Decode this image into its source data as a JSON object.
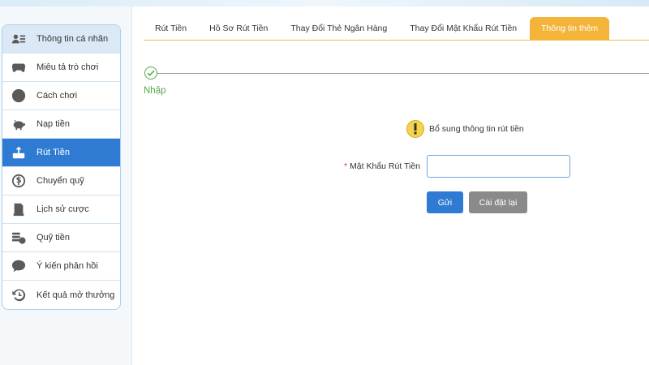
{
  "sidebar": {
    "items": [
      {
        "label": "Thông tin cá nhân",
        "icon": "profile-card-icon"
      },
      {
        "label": "Miêu tả trò chơi",
        "icon": "gamepad-icon"
      },
      {
        "label": "Cách chơi",
        "icon": "info-icon"
      },
      {
        "label": "Nạp tiền",
        "icon": "piggy-bank-icon"
      },
      {
        "label": "Rút Tiền",
        "icon": "withdraw-icon"
      },
      {
        "label": "Chuyển quỹ",
        "icon": "coin-icon"
      },
      {
        "label": "Lịch sử cược",
        "icon": "history-list-icon"
      },
      {
        "label": "Quỹ tiền",
        "icon": "money-stack-icon"
      },
      {
        "label": "Ý kiến phản hồi",
        "icon": "chat-bubble-icon"
      },
      {
        "label": "Kết quả mở thưởng",
        "icon": "clock-history-icon"
      }
    ],
    "active_index": 4
  },
  "tabs": [
    {
      "label": "Rút Tiền"
    },
    {
      "label": "Hồ Sơ Rút Tiền"
    },
    {
      "label": "Thay Đổi Thẻ Ngân Hàng"
    },
    {
      "label": "Thay Đổi Mật Khẩu Rút Tiền"
    },
    {
      "label": "Thông tin thêm"
    }
  ],
  "active_tab": 4,
  "step": {
    "label": "Nhập"
  },
  "notice": {
    "text": "Bổ sung thông tin rút tiền"
  },
  "form": {
    "required_mark": "*",
    "password_label": "Mật Khẩu Rút Tiền",
    "password_value": "",
    "submit_label": "Gửi",
    "reset_label": "Cài đặt lại"
  },
  "colors": {
    "accent_blue": "#2f7bd3",
    "tab_orange": "#f4b43a",
    "step_green": "#5aa64a",
    "reset_gray": "#8a8a8a"
  }
}
